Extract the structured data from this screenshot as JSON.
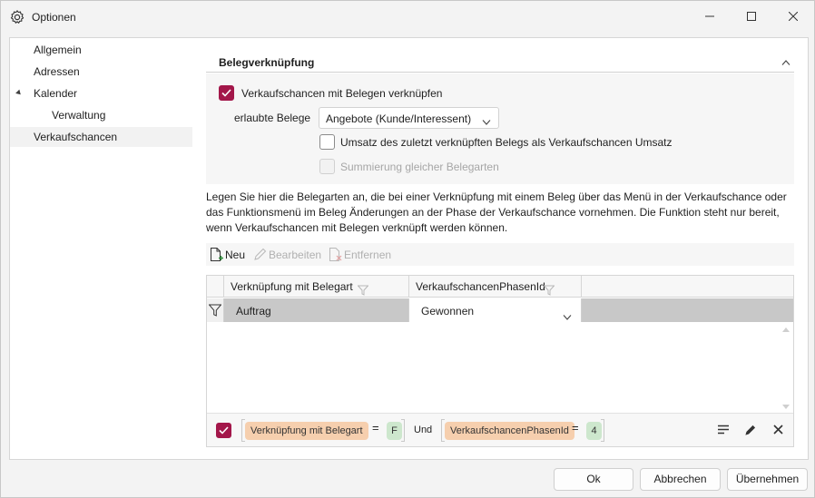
{
  "window": {
    "title": "Optionen"
  },
  "nav": {
    "items": [
      {
        "label": "Allgemein"
      },
      {
        "label": "Adressen"
      },
      {
        "label": "Kalender"
      },
      {
        "label": "Verwaltung"
      },
      {
        "label": "Verkaufschancen"
      }
    ]
  },
  "section": {
    "title": "Belegverknüpfung"
  },
  "options": {
    "link_checkbox_label": "Verkaufschancen mit Belegen verknüpfen",
    "link_checked": true,
    "allowed_label": "erlaubte Belege",
    "allowed_value": "Angebote (Kunde/Interessent)",
    "umsatz_label": "Umsatz des zuletzt verknüpften Belegs als Verkaufschancen Umsatz",
    "summierung_label": "Summierung gleicher Belegarten"
  },
  "info": {
    "text": "Legen Sie hier die Belegarten an, die bei einer Verknüpfung mit einem Beleg über das Menü in der Verkaufschance oder das Funktionsmenü im Beleg Änderungen an der Phase der Verkaufschance vornehmen. Die Funktion steht nur bereit, wenn Verkaufschancen mit Belegen verknüpft werden können."
  },
  "toolbar": {
    "new_label": "Neu",
    "edit_label": "Bearbeiten",
    "remove_label": "Entfernen"
  },
  "grid": {
    "columns": [
      "Verknüpfung mit Belegart",
      "VerkaufschancenPhasenId"
    ],
    "filter_row": {
      "col1": "Auftrag",
      "col2": "Gewonnen"
    }
  },
  "filter_panel": {
    "field1": "Verknüpfung mit Belegart",
    "op1": "=",
    "value1": "F",
    "conjunction": "Und",
    "field2": "VerkaufschancenPhasenId",
    "op2": "=",
    "value2": "4"
  },
  "buttons": {
    "ok": "Ok",
    "cancel": "Abbrechen",
    "apply": "Übernehmen"
  },
  "colors": {
    "accent": "#a3174a",
    "field_pill": "#f6cfae",
    "value_pill": "#cde7cd"
  }
}
